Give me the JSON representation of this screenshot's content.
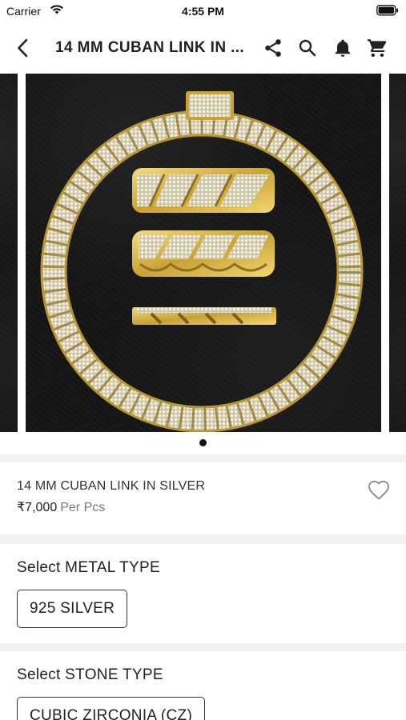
{
  "status_bar": {
    "carrier": "Carrier",
    "time": "4:55 PM"
  },
  "header": {
    "title": "14 MM CUBAN LINK IN ...",
    "icons": [
      "back-arrow-icon",
      "share-icon",
      "search-icon",
      "bell-icon",
      "cart-icon"
    ]
  },
  "carousel": {
    "slide_count": 1,
    "active_index": 0,
    "image_description_colors": {
      "background": "#161616",
      "gold": "#d8b84a",
      "diamond": "#eee9d5"
    }
  },
  "product": {
    "name": "14 MM CUBAN LINK IN SILVER",
    "price": "₹7,000",
    "unit": "Per Pcs"
  },
  "metal_type": {
    "label": "Select METAL TYPE",
    "selected": "925 SILVER"
  },
  "stone_type": {
    "label": "Select STONE TYPE",
    "selected": "CUBIC ZIRCONIA (CZ)"
  }
}
